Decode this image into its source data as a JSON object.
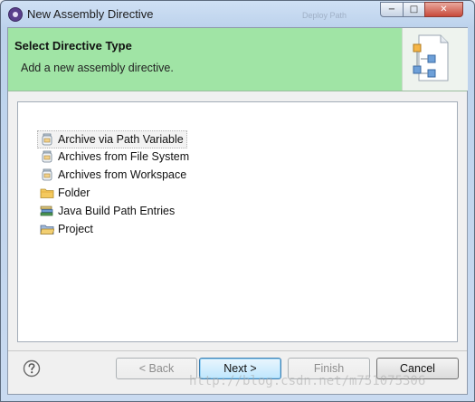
{
  "window": {
    "title": "New Assembly Directive",
    "ghost_title": "Deploy Path",
    "controls": {
      "minimize": "−",
      "maximize": "□",
      "close": "✕"
    }
  },
  "header": {
    "title": "Select Directive Type",
    "subtitle": "Add a new assembly directive."
  },
  "tree": {
    "items": [
      {
        "label": "Archive via Path Variable",
        "icon": "jar-icon",
        "selected": true
      },
      {
        "label": "Archives from File System",
        "icon": "jar-icon"
      },
      {
        "label": "Archives from Workspace",
        "icon": "jar-icon"
      },
      {
        "label": "Folder",
        "icon": "folder-icon"
      },
      {
        "label": "Java Build Path Entries",
        "icon": "library-icon"
      },
      {
        "label": "Project",
        "icon": "project-folder-icon"
      }
    ]
  },
  "buttons": {
    "back": "< Back",
    "next": "Next >",
    "finish": "Finish",
    "cancel": "Cancel"
  },
  "watermark": "http://blog.csdn.net/m751075306"
}
